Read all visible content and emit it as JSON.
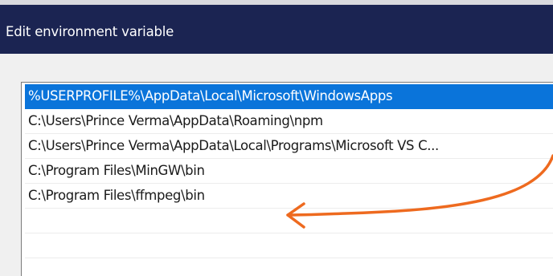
{
  "window": {
    "title": "Edit environment variable"
  },
  "list": {
    "items": [
      {
        "label": "%USERPROFILE%\\AppData\\Local\\Microsoft\\WindowsApps",
        "selected": true
      },
      {
        "label": "C:\\Users\\Prince Verma\\AppData\\Roaming\\npm",
        "selected": false
      },
      {
        "label": "C:\\Users\\Prince Verma\\AppData\\Local\\Programs\\Microsoft VS C...",
        "selected": false
      },
      {
        "label": "C:\\Program Files\\MinGW\\bin",
        "selected": false
      },
      {
        "label": "C:\\Program Files\\ffmpeg\\bin",
        "selected": false
      },
      {
        "label": "",
        "selected": false
      },
      {
        "label": "",
        "selected": false
      }
    ]
  },
  "colors": {
    "titlebar": "#1b2452",
    "selection": "#0a74da",
    "annotation_arrow": "#ee6a1f"
  }
}
